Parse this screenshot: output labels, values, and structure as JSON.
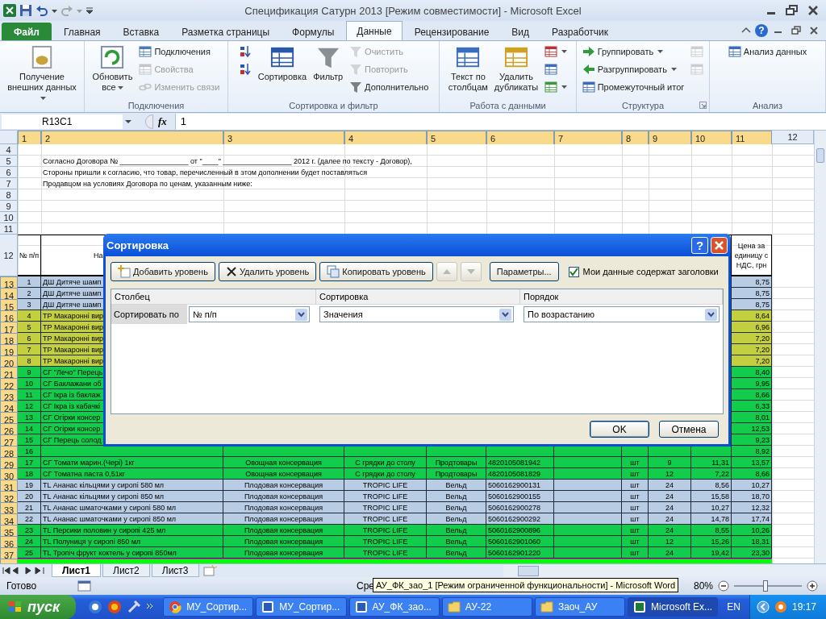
{
  "window": {
    "title": "Спецификация Сатурн 2013  [Режим совместимости] - Microsoft Excel",
    "help": "?"
  },
  "ribbon": {
    "tabs": [
      {
        "label": "Файл",
        "selected": false,
        "kind": "file"
      },
      {
        "label": "Главная",
        "selected": false,
        "kind": "tab"
      },
      {
        "label": "Вставка",
        "selected": false,
        "kind": "tab"
      },
      {
        "label": "Разметка страницы",
        "selected": false,
        "kind": "tab"
      },
      {
        "label": "Формулы",
        "selected": false,
        "kind": "tab"
      },
      {
        "label": "Данные",
        "selected": true,
        "kind": "tab"
      },
      {
        "label": "Рецензирование",
        "selected": false,
        "kind": "tab"
      },
      {
        "label": "Вид",
        "selected": false,
        "kind": "tab"
      },
      {
        "label": "Разработчик",
        "selected": false,
        "kind": "tab"
      }
    ],
    "groups": [
      {
        "items": [
          {
            "kind": "large",
            "label": "Получение\nвнешних данных",
            "dropdown": true,
            "disabled": false
          }
        ]
      },
      {
        "label": "Подключения",
        "launcher": false,
        "items": [
          {
            "kind": "large",
            "label": "Обновить\nвсе",
            "dropdown": true,
            "disabled": false
          },
          {
            "kind": "stack",
            "items": [
              {
                "label": "Подключения",
                "disabled": false,
                "dropdown": false
              },
              {
                "label": "Свойства",
                "disabled": true,
                "dropdown": false
              },
              {
                "label": "Изменить связи",
                "disabled": true,
                "dropdown": false
              }
            ]
          }
        ]
      },
      {
        "label": "Сортировка и фильтр",
        "launcher": false,
        "items": [
          {
            "kind": "stack",
            "items": [
              {
                "disabled": false,
                "dropdown": false
              },
              {
                "disabled": false,
                "dropdown": false
              }
            ]
          },
          {
            "kind": "large",
            "label": "Сортировка",
            "dropdown": false,
            "disabled": false
          },
          {
            "kind": "large",
            "label": "Фильтр",
            "dropdown": false,
            "disabled": false
          },
          {
            "kind": "stack",
            "items": [
              {
                "label": "Очистить",
                "disabled": true,
                "dropdown": false
              },
              {
                "label": "Повторить",
                "disabled": true,
                "dropdown": false
              },
              {
                "label": "Дополнительно",
                "disabled": false,
                "dropdown": false
              }
            ]
          }
        ]
      },
      {
        "label": "Работа с данными",
        "launcher": false,
        "items": [
          {
            "kind": "large",
            "label": "Текст по\nстолбцам",
            "dropdown": false,
            "disabled": false
          },
          {
            "kind": "large",
            "label": "Удалить\nдубликаты",
            "dropdown": false,
            "disabled": false
          },
          {
            "kind": "stack",
            "items": [
              {
                "disabled": false,
                "dropdown": true
              },
              {
                "disabled": false,
                "dropdown": false
              },
              {
                "disabled": false,
                "dropdown": true
              }
            ]
          }
        ]
      },
      {
        "label": "Структура",
        "launcher": true,
        "items": [
          {
            "kind": "stack",
            "items": [
              {
                "label": "Группировать",
                "disabled": false,
                "dropdown": true
              },
              {
                "label": "Разгруппировать",
                "disabled": false,
                "dropdown": true
              },
              {
                "label": "Промежуточный итог",
                "disabled": false,
                "dropdown": false
              }
            ]
          },
          {
            "kind": "stack",
            "items": [
              {
                "disabled": true,
                "dropdown": false
              },
              {
                "disabled": true,
                "dropdown": false
              }
            ]
          }
        ]
      },
      {
        "label": "Анализ",
        "launcher": false,
        "items": [
          {
            "kind": "stack",
            "items": [
              {
                "label": "Анализ данных",
                "disabled": false,
                "dropdown": false
              }
            ]
          }
        ]
      }
    ]
  },
  "formula_bar": {
    "name_box": "R13C1",
    "function_label": "fx",
    "value": "1"
  },
  "sheet": {
    "columns": [
      {
        "label": "1",
        "selected": true
      },
      {
        "label": "2",
        "selected": true
      },
      {
        "label": "3",
        "selected": true
      },
      {
        "label": "4",
        "selected": true
      },
      {
        "label": "5",
        "selected": true
      },
      {
        "label": "6",
        "selected": true
      },
      {
        "label": "7",
        "selected": true
      },
      {
        "label": "8",
        "selected": true
      },
      {
        "label": "9",
        "selected": true
      },
      {
        "label": "10",
        "selected": true
      },
      {
        "label": "11",
        "selected": true
      },
      {
        "label": "12",
        "selected": false
      }
    ],
    "top_rows": [
      {
        "header": "4"
      },
      {
        "header": "5",
        "text": "Согласно Договора № _________________ от \"____\" _________________ 2012 г. (далее по тексту - Договор),"
      },
      {
        "header": "6",
        "text": "Стороны пришли к согласию, что товар, перечисленный в этом дополнении будет поставляться"
      },
      {
        "header": "7",
        "text": "Продавцом на условиях Договора по ценам, указанным ниже:"
      },
      {
        "header": "8"
      },
      {
        "header": "9"
      },
      {
        "header": "10"
      },
      {
        "header": "11"
      }
    ],
    "header_row": {
      "header": "12",
      "column_1": "№ п/п",
      "column_2": "На",
      "column_11": "Цена за единицу с НДС, грн"
    },
    "items": [
      {
        "header": "13",
        "selected": true,
        "color": "#b8cce4",
        "column_1": "1",
        "column_2": "ДШ Дитяче шамп",
        "column_11": "8,75"
      },
      {
        "header": "14",
        "selected": true,
        "color": "#b8cce4",
        "column_1": "2",
        "column_2": "ДШ Дитяче шамп",
        "column_11": "8,75"
      },
      {
        "header": "15",
        "selected": true,
        "color": "#b8cce4",
        "column_1": "3",
        "column_2": "ДШ Дитяче шамп",
        "column_11": "8,75"
      },
      {
        "header": "16",
        "selected": true,
        "color": "#c4cf3f",
        "column_1": "4",
        "column_2": "ТР Макаронні вир",
        "column_11": "8,64"
      },
      {
        "header": "17",
        "selected": true,
        "color": "#c4cf3f",
        "column_1": "5",
        "column_2": "ТР Макаронні вир",
        "column_11": "6,96"
      },
      {
        "header": "18",
        "selected": true,
        "color": "#c4cf3f",
        "column_1": "6",
        "column_2": "ТР Макаронні вир",
        "column_11": "7,20"
      },
      {
        "header": "19",
        "selected": true,
        "color": "#c4cf3f",
        "column_1": "7",
        "column_2": "ТР Макаронні вир",
        "column_11": "7,20"
      },
      {
        "header": "20",
        "selected": true,
        "color": "#c4cf3f",
        "column_1": "8",
        "column_2": "ТР Макаронні вир",
        "column_11": "7,20"
      },
      {
        "header": "21",
        "selected": true,
        "color": "#12cc4c",
        "column_1": "9",
        "column_2": "СГ \"Лечо\" Перець",
        "column_11": "8,40"
      },
      {
        "header": "22",
        "selected": true,
        "color": "#12cc4c",
        "column_1": "10",
        "column_2": "СГ Баклажани об",
        "column_11": "9,95"
      },
      {
        "header": "23",
        "selected": true,
        "color": "#12cc4c",
        "column_1": "11",
        "column_2": "СГ Ікра із баклаж",
        "column_11": "8,66"
      },
      {
        "header": "24",
        "selected": true,
        "color": "#12cc4c",
        "column_1": "12",
        "column_2": "СГ Ікра із кабачкі",
        "column_11": "6,33"
      },
      {
        "header": "25",
        "selected": true,
        "color": "#12cc4c",
        "column_1": "13",
        "column_2": "СГ Огірки консер",
        "column_11": "8,01"
      },
      {
        "header": "26",
        "selected": true,
        "color": "#12cc4c",
        "column_1": "14",
        "column_2": "СГ Огірки консер",
        "column_11": "12,53"
      },
      {
        "header": "27",
        "selected": true,
        "color": "#12cc4c",
        "column_1": "15",
        "column_2": "СГ Перець солод",
        "column_11": "9,23"
      },
      {
        "header": "28",
        "selected": true,
        "color": "#12cc4c",
        "column_1": "16",
        "column_11": "8,92"
      },
      {
        "header": "29",
        "selected": true,
        "color": "#12cc4c",
        "column_1": "17",
        "column_2": "СГ Томати марин.(Чері) 1кг",
        "column_3": "Овощная консервация",
        "column_4": "С грядки до столу",
        "column_5": "Продтовары",
        "column_6": "4820105081942",
        "column_8": "шт",
        "column_9": "9",
        "column_10": "11,31",
        "column_11": "13,57"
      },
      {
        "header": "30",
        "selected": true,
        "color": "#12cc4c",
        "column_1": "18",
        "column_2": "СГ Томатна паста 0,51кг",
        "column_3": "Овощная консервация",
        "column_4": "С грядки до столу",
        "column_5": "Продтовары",
        "column_6": "4820105081829",
        "column_8": "шт",
        "column_9": "12",
        "column_10": "7,22",
        "column_11": "8,66"
      },
      {
        "header": "31",
        "selected": true,
        "color": "#b8cce4",
        "column_1": "19",
        "column_2": "TL Ананас кільцями у сиропі 580 мл",
        "column_3": "Плодовая консервация",
        "column_4": "TROPIC LIFE",
        "column_5": "Вельд",
        "column_6": "5060162900131",
        "column_8": "шт",
        "column_9": "24",
        "column_10": "8,56",
        "column_11": "10,27"
      },
      {
        "header": "32",
        "selected": true,
        "color": "#b8cce4",
        "column_1": "20",
        "column_2": "TL Ананас кільцями у сиропі 850 мл",
        "column_3": "Плодовая консервация",
        "column_4": "TROPIC LIFE",
        "column_5": "Вельд",
        "column_6": "5060162900155",
        "column_8": "шт",
        "column_9": "24",
        "column_10": "15,58",
        "column_11": "18,70"
      },
      {
        "header": "33",
        "selected": true,
        "color": "#b8cce4",
        "column_1": "21",
        "column_2": "TL Ананас шматочками у сиропі 580 мл",
        "column_3": "Плодовая консервация",
        "column_4": "TROPIC LIFE",
        "column_5": "Вельд",
        "column_6": "5060162900278",
        "column_8": "шт",
        "column_9": "24",
        "column_10": "10,27",
        "column_11": "12,32"
      },
      {
        "header": "34",
        "selected": true,
        "color": "#b8cce4",
        "column_1": "22",
        "column_2": "TL Ананас шматочками у сиропі 850 мл",
        "column_3": "Плодовая консервация",
        "column_4": "TROPIC LIFE",
        "column_5": "Вельд",
        "column_6": "5060162900292",
        "column_8": "шт",
        "column_9": "24",
        "column_10": "14,78",
        "column_11": "17,74"
      },
      {
        "header": "35",
        "selected": true,
        "color": "#12cc4c",
        "column_1": "23",
        "column_2": "TL Персики половин у сиропі 425 мл",
        "column_3": "Плодовая консервация",
        "column_4": "TROPIC LIFE",
        "column_5": "Вельд",
        "column_6": "5060162900896",
        "column_8": "шт",
        "column_9": "24",
        "column_10": "8,55",
        "column_11": "10,26"
      },
      {
        "header": "36",
        "selected": true,
        "color": "#12cc4c",
        "column_1": "24",
        "column_2": "TL Полуниця у сиропі 850 мл",
        "column_3": "Плодовая консервация",
        "column_4": "TROPIC LIFE",
        "column_5": "Вельд",
        "column_6": "5060162901060",
        "column_8": "шт",
        "column_9": "12",
        "column_10": "15,26",
        "column_11": "18,31"
      },
      {
        "header": "37",
        "selected": true,
        "color": "#12cc4c",
        "column_1": "25",
        "column_2": "TL Тропіч фрукт коктель у сиропі 850мл",
        "column_3": "Плодовая консервация",
        "column_4": "TROPIC LIFE",
        "column_5": "Вельд",
        "column_6": "5060162901220",
        "column_8": "шт",
        "column_9": "24",
        "column_10": "19,42",
        "column_11": "23,30"
      }
    ],
    "partial_row": {
      "color": "#00ff00"
    }
  },
  "dialog": {
    "title": "Сортировка",
    "help": "?",
    "toolbar": [
      {
        "kind": "add",
        "label": "Добавить уровень",
        "disabled": false
      },
      {
        "kind": "delete",
        "label": "Удалить уровень",
        "disabled": false
      },
      {
        "kind": "copy",
        "label": "Копировать уровень",
        "disabled": false
      },
      {
        "kind": "up",
        "disabled": true
      },
      {
        "kind": "down",
        "disabled": true
      },
      {
        "kind": "text",
        "label": "Параметры...",
        "disabled": false
      }
    ],
    "checkbox": {
      "label": "Мои данные содержат заголовки",
      "checked": true
    },
    "columns": [
      "Столбец",
      "Сортировка",
      "Порядок"
    ],
    "levels": [
      {
        "label": "Сортировать по",
        "selected": true,
        "column": "№ п/п",
        "sort": "Значения",
        "order": "По возрастанию"
      }
    ],
    "buttons": [
      "OK",
      "Отмена"
    ]
  },
  "sheet_tabs": [
    {
      "label": "Лист1",
      "selected": true
    },
    {
      "label": "Лист2",
      "selected": false
    },
    {
      "label": "Лист3",
      "selected": false
    }
  ],
  "status_bar": {
    "status": "Готово",
    "partial": "Сре",
    "zoom": "80%",
    "level": 0.47
  },
  "tooltip": "АУ_ФК_зао_1 [Режим ограниченной функциональности] - Microsoft Word",
  "taskbar": {
    "start": "пуск",
    "items": [
      {
        "label": "МУ_Сортир...",
        "selected": false
      },
      {
        "label": "МУ_Сортир...",
        "selected": false
      },
      {
        "label": "АУ_ФК_зао...",
        "selected": false
      },
      {
        "label": "АУ-22",
        "selected": false
      },
      {
        "label": "Заоч_АУ",
        "selected": false
      },
      {
        "label": "Microsoft Ex...",
        "selected": true
      }
    ],
    "language": "EN",
    "clock": "19:17"
  }
}
